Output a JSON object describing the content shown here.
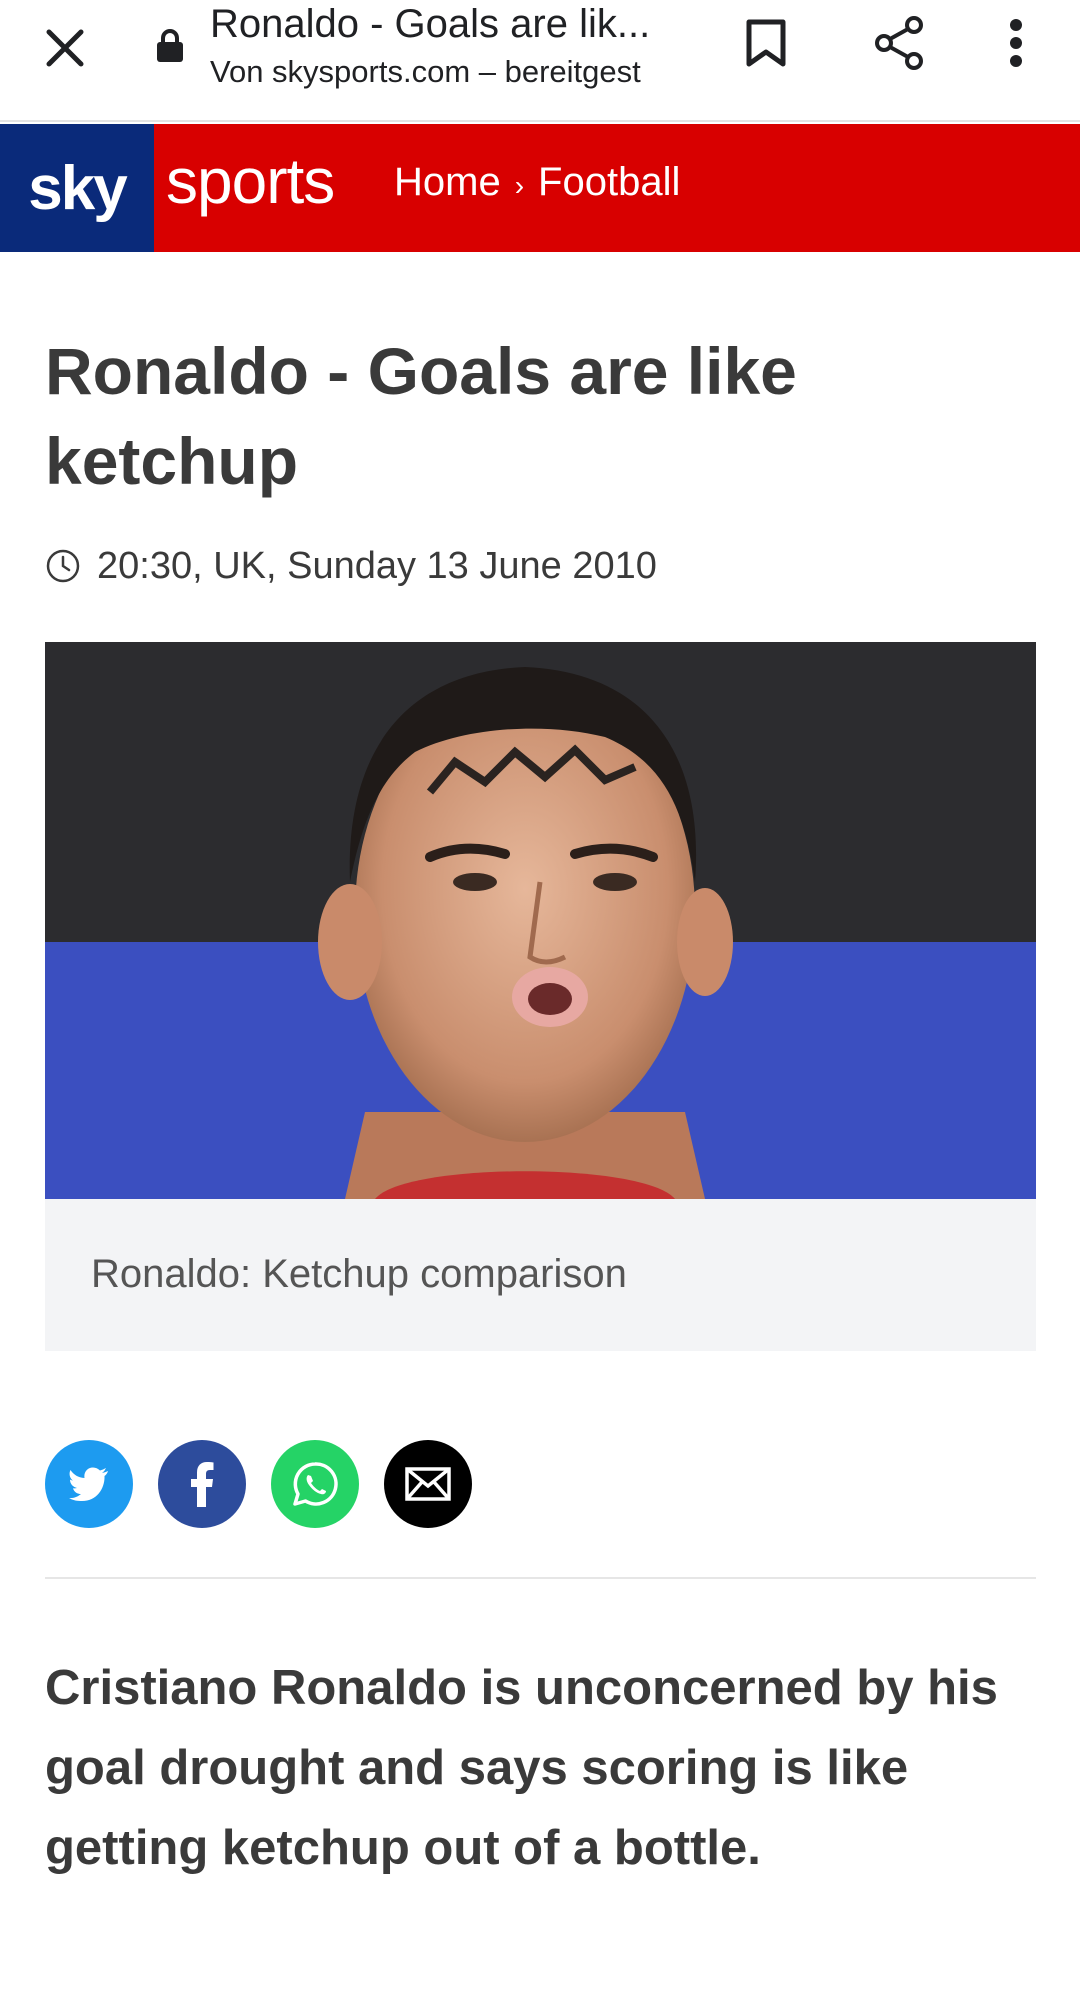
{
  "browser": {
    "title": "Ronaldo - Goals are lik...",
    "subtitle": "Von skysports.com – bereitgest",
    "close_icon": "close-icon",
    "lock_icon": "lock-icon",
    "bookmark_icon": "bookmark-icon",
    "share_icon": "share-icon",
    "menu_icon": "more-vert-icon"
  },
  "brand": {
    "logo_sky": "sky",
    "logo_sports": "sports",
    "breadcrumb": [
      "Home",
      "Football"
    ],
    "separator": "›",
    "red": "#d80000",
    "navy": "#0a2a7a"
  },
  "article": {
    "headline": "Ronaldo - Goals are like ketchup",
    "timestamp": "20:30, UK, Sunday 13 June 2010",
    "image_caption": "Ronaldo: Ketchup comparison",
    "lede": "Cristiano Ronaldo is unconcerned by his goal drought and says scoring is like getting ketchup out of a bottle."
  },
  "share": [
    {
      "name": "twitter",
      "color": "#1d9bf0"
    },
    {
      "name": "facebook",
      "color": "#2d4c9c"
    },
    {
      "name": "whatsapp",
      "color": "#25d366"
    },
    {
      "name": "email",
      "color": "#000000"
    }
  ]
}
